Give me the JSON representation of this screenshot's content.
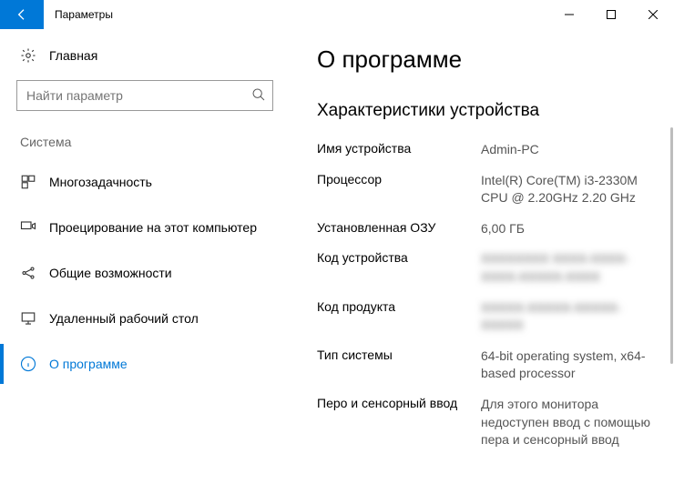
{
  "window": {
    "title": "Параметры"
  },
  "sidebar": {
    "home": "Главная",
    "search_placeholder": "Найти параметр",
    "category": "Система",
    "items": [
      {
        "label": "Многозадачность"
      },
      {
        "label": "Проецирование на этот компьютер"
      },
      {
        "label": "Общие возможности"
      },
      {
        "label": "Удаленный рабочий стол"
      },
      {
        "label": "О программе"
      }
    ]
  },
  "page": {
    "title": "О программе",
    "section": "Характеристики устройства",
    "specs": {
      "device_name_label": "Имя устройства",
      "device_name": "Admin-PC",
      "processor_label": "Процессор",
      "processor": "Intel(R) Core(TM) i3-2330M CPU @ 2.20GHz 2.20 GHz",
      "ram_label": "Установленная ОЗУ",
      "ram": "6,00 ГБ",
      "device_id_label": "Код устройства",
      "device_id": "XXXXXXXX\nXXXX-XXXX-XXXX-XXXXX-XXXX",
      "product_id_label": "Код продукта",
      "product_id": "XXXXX-XXXXX-XXXXX-XXXXX",
      "system_type_label": "Тип системы",
      "system_type": "64-bit operating system, x64-based processor",
      "pen_touch_label": "Перо и сенсорный ввод",
      "pen_touch": "Для этого монитора недоступен ввод с помощью пера и сенсорный ввод"
    }
  }
}
